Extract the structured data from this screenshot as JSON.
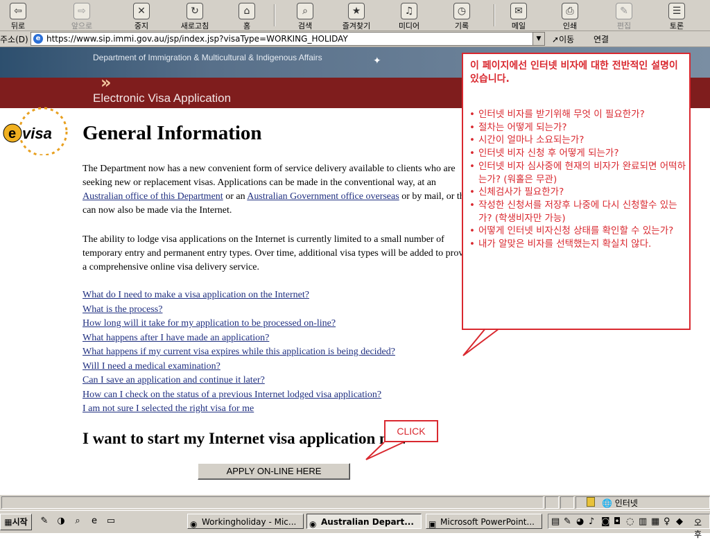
{
  "toolbar": {
    "buttons": [
      {
        "label": "뒤로",
        "icon": "back-arrow-icon",
        "enabled": true
      },
      {
        "label": "앞으로",
        "icon": "forward-arrow-icon",
        "enabled": false
      },
      {
        "label": "중지",
        "icon": "stop-icon",
        "enabled": true
      },
      {
        "label": "새로고침",
        "icon": "refresh-icon",
        "enabled": true
      },
      {
        "label": "홈",
        "icon": "home-icon",
        "enabled": true
      },
      {
        "label": "검색",
        "icon": "search-icon",
        "enabled": true
      },
      {
        "label": "즐겨찾기",
        "icon": "favorites-icon",
        "enabled": true
      },
      {
        "label": "미디어",
        "icon": "media-icon",
        "enabled": true
      },
      {
        "label": "기록",
        "icon": "history-icon",
        "enabled": true
      },
      {
        "label": "메일",
        "icon": "mail-icon",
        "enabled": true
      },
      {
        "label": "인쇄",
        "icon": "print-icon",
        "enabled": true
      },
      {
        "label": "편집",
        "icon": "edit-icon",
        "enabled": false
      },
      {
        "label": "토론",
        "icon": "discuss-icon",
        "enabled": true
      }
    ]
  },
  "address": {
    "label": "주소(D)",
    "url": "https://www.sip.immi.gov.au/jsp/index.jsp?visaType=WORKING_HOLIDAY",
    "go": "이동",
    "links": "연결"
  },
  "page": {
    "dept": "Department of Immigration & Multicultural & Indigenous Affairs",
    "app_title": "Electronic Visa Application",
    "logo_text": "evisa",
    "heading": "General Information",
    "p1": {
      "t1": "The Department now has a new convenient form of service delivery available to clients who are seeking new or replacement visas. Applications can be made in the conventional way, at an ",
      "l1": "Australian office of this Department",
      "t2": " or an ",
      "l2": "Australian Government office overseas",
      "t3": " or by mail, or they can now also be made via the Internet."
    },
    "p2": "The ability to lodge visa applications on the Internet is currently limited to a small number of temporary entry and permanent entry types. Over time, additional visa types will be added to provide a comprehensive online visa delivery service.",
    "links": [
      "What do I need to make a visa application on the Internet?",
      "What is the process?",
      "How long will it take for my application to be processed on-line?",
      "What happens after I have made an application?",
      "What happens if my current visa expires while this application is being decided?",
      "Will I need a medical examination?",
      "Can I save an application and continue it later?",
      "How can I check on the status of a previous Internet lodged visa application?",
      "I am not sure I selected the right visa for me"
    ],
    "start_heading": "I want to start my Internet visa application now",
    "apply_button": "APPLY ON-LINE HERE"
  },
  "callout": {
    "title": "이 페이지에선 인터넷 비자에 대한 전반적인 설명이 있습니다.",
    "items": [
      "인터넷 비자를 받기위해 무엇 이 필요한가?",
      "절차는 어떻게 되는가?",
      "시간이 얼마나 소요되는가?",
      "인터넷 비자 신청 후 어떻게 되는가?",
      "인터넷 비자 심사중에 현재의 비자가 완료되면 어떡하는가? (워홀은 무관)",
      "신체검사가 필요한가?",
      "작성한 신청서를 저장후 나중에 다시 신청할수 있는가? (학생비자만 가능)",
      "어떻게 인터넷 비자신청 상태를 확인할 수 있는가?",
      "내가 알맞은 비자를 선택했는지 확실치 않다."
    ],
    "click_label": "CLICK",
    "color": "#d9282f"
  },
  "statusbar": {
    "zone": "인터넷"
  },
  "taskbar": {
    "start": "시작",
    "tasks": [
      {
        "label": "Workingholiday - Mic...",
        "active": false
      },
      {
        "label": "Australian Depart...",
        "active": true
      },
      {
        "label": "Microsoft PowerPoint...",
        "active": false
      }
    ],
    "clock": "오후"
  }
}
